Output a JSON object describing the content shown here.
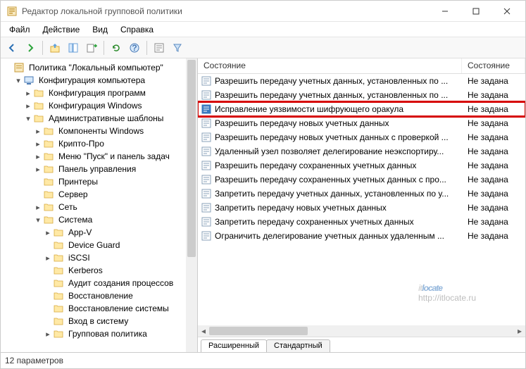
{
  "window": {
    "title": "Редактор локальной групповой политики"
  },
  "menu": {
    "file": "Файл",
    "action": "Действие",
    "view": "Вид",
    "help": "Справка"
  },
  "tree": {
    "root": "Политика \"Локальный компьютер\"",
    "computer_config": "Конфигурация компьютера",
    "software_settings": "Конфигурация программ",
    "windows_settings": "Конфигурация Windows",
    "admin_templates": "Административные шаблоны",
    "windows_components": "Компоненты Windows",
    "crypto_pro": "Крипто-Про",
    "start_menu": "Меню \"Пуск\" и панель задач",
    "control_panel": "Панель управления",
    "printers": "Принтеры",
    "server": "Сервер",
    "network": "Сеть",
    "system": "Система",
    "app_v": "App-V",
    "device_guard": "Device Guard",
    "iscsi": "iSCSI",
    "kerberos": "Kerberos",
    "process_audit": "Аудит создания процессов",
    "restore": "Восстановление",
    "system_restore": "Восстановление системы",
    "logon": "Вход в систему",
    "group_policy": "Групповая политика"
  },
  "list_header": {
    "col1": "Состояние",
    "col2": "Состояние"
  },
  "settings": [
    {
      "label": "Разрешить передачу учетных данных, установленных по ...",
      "state": "Не задана",
      "selected": false
    },
    {
      "label": "Разрешить передачу учетных данных, установленных по ...",
      "state": "Не задана",
      "selected": false
    },
    {
      "label": "Исправление уязвимости шифрующего оракула",
      "state": "Не задана",
      "selected": true
    },
    {
      "label": "Разрешить передачу новых учетных данных",
      "state": "Не задана",
      "selected": false
    },
    {
      "label": "Разрешить передачу новых учетных данных с проверкой ...",
      "state": "Не задана",
      "selected": false
    },
    {
      "label": "Удаленный узел позволяет делегирование неэкспортиру...",
      "state": "Не задана",
      "selected": false
    },
    {
      "label": "Разрешить передачу сохраненных учетных данных",
      "state": "Не задана",
      "selected": false
    },
    {
      "label": "Разрешить передачу сохраненных учетных данных с про...",
      "state": "Не задана",
      "selected": false
    },
    {
      "label": "Запретить передачу учетных данных, установленных по у...",
      "state": "Не задана",
      "selected": false
    },
    {
      "label": "Запретить передачу новых учетных данных",
      "state": "Не задана",
      "selected": false
    },
    {
      "label": "Запретить передачу сохраненных учетных данных",
      "state": "Не задана",
      "selected": false
    },
    {
      "label": "Ограничить делегирование учетных данных удаленным ...",
      "state": "Не задана",
      "selected": false
    }
  ],
  "tabs": {
    "extended": "Расширенный",
    "standard": "Стандартный"
  },
  "statusbar": {
    "text": "12 параметров"
  },
  "watermark": {
    "brand_grey": "it",
    "brand_blue": "locate",
    "url": "http://itlocate.ru"
  },
  "icons": {
    "back": "back-icon",
    "forward": "forward-icon",
    "up": "up-icon",
    "show": "show-icon",
    "export": "export-icon",
    "refresh": "refresh-icon",
    "help": "help-icon",
    "properties": "properties-icon",
    "filter": "filter-icon"
  }
}
